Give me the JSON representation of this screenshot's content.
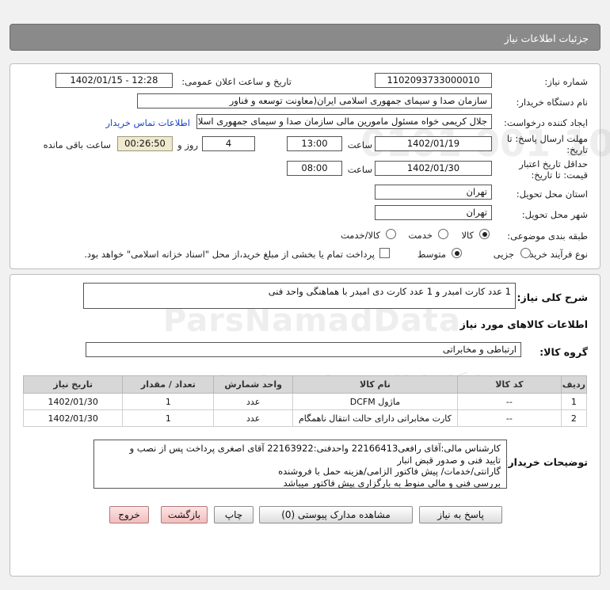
{
  "header": {
    "title": "جزئیات اطلاعات نیاز"
  },
  "watermark": {
    "logo_text": "ParsNamadData",
    "logo_fa": "پایگاه اطلاع رسانی مناقصات",
    "phone": "۰۲۱-۸۸۳۴۹۶۷۰-۵",
    "numbers": "0101 001 10"
  },
  "info": {
    "need_number_label": "شماره نیاز:",
    "need_number": "1102093733000010",
    "announce_label": "تاریخ و ساعت اعلان عمومی:",
    "announce_value": "1402/01/15 - 12:28",
    "buyer_org_label": "نام دستگاه خریدار:",
    "buyer_org": "سازمان صدا و سیمای جمهوری اسلامی ایران(معاونت توسعه و فناور",
    "creator_label": "ایجاد کننده درخواست:",
    "creator": "جلال کریمی خواه مسئول مامورین مالی  سازمان صدا و سیمای جمهوری اسلا",
    "contact_link": "اطلاعات تماس خریدار",
    "deadline_label_1": "مهلت ارسال پاسخ: تا",
    "deadline_label_2": "تاریخ:",
    "deadline_date": "1402/01/19",
    "time_label": "ساعت",
    "deadline_time": "13:00",
    "days_value": "4",
    "days_label": "روز و",
    "remaining_time": "00:26:50",
    "remaining_label": "ساعت باقی مانده",
    "validity_label_1": "حداقل تاریخ اعتبار",
    "validity_label_2": "قیمت: تا تاریخ:",
    "validity_date": "1402/01/30",
    "validity_time_label": "ساعت",
    "validity_time": "08:00",
    "province_label": "استان محل تحویل:",
    "province": "تهران",
    "city_label": "شهر محل تحویل:",
    "city": "تهران",
    "category_label": "طبقه بندی موضوعی:",
    "category_options": [
      "کالا",
      "خدمت",
      "کالا/خدمت"
    ],
    "process_label": "نوع فرآیند خرید :",
    "process_options": [
      "جزیی",
      "متوسط"
    ],
    "treasury_note": "پرداخت تمام یا بخشی از مبلغ خرید،از محل \"اسناد خزانه اسلامی\" خواهد بود."
  },
  "summary": {
    "label": "شرح کلی نیاز:",
    "text": "1 عدد کارت امبدر و 1 عدد کارت دی امبدر با هماهنگی واحد فنی"
  },
  "goods": {
    "section_title": "اطلاعات کالاهای مورد نیاز",
    "group_label": "گروه کالا:",
    "group_value": "ارتباطی و مخابراتی",
    "columns": [
      "ردیف",
      "کد کالا",
      "نام کالا",
      "واحد شمارش",
      "تعداد / مقدار",
      "تاریخ نیاز"
    ],
    "rows": [
      {
        "row": "1",
        "code": "--",
        "name": "ماژول DCFM",
        "unit": "عدد",
        "qty": "1",
        "date": "1402/01/30"
      },
      {
        "row": "2",
        "code": "--",
        "name": "کارت مخابراتی دارای حالت انتقال ناهمگام",
        "unit": "عدد",
        "qty": "1",
        "date": "1402/01/30"
      }
    ]
  },
  "buyer_notes": {
    "label": "توضیحات خریدار:",
    "lines": [
      "کارشناس مالی:آقای رافعی22166413  واحدفنی:22163922 آقای اصغری  پرداخت پس از  نصب و",
      "تایید فنی و صدور قبض انبار",
      "گارانتی/خدمات/ پیش فاکتور الزامی/هزینه حمل با فروشنده",
      "بررسی فنی و مالی منوط به بارگزاری پیش فاکتور میباشد"
    ]
  },
  "buttons": {
    "reply": "پاسخ به نیاز",
    "attachments": "مشاهده مدارک پیوستی (0)",
    "print": "چاپ",
    "back": "بازگشت",
    "exit": "خروج"
  }
}
